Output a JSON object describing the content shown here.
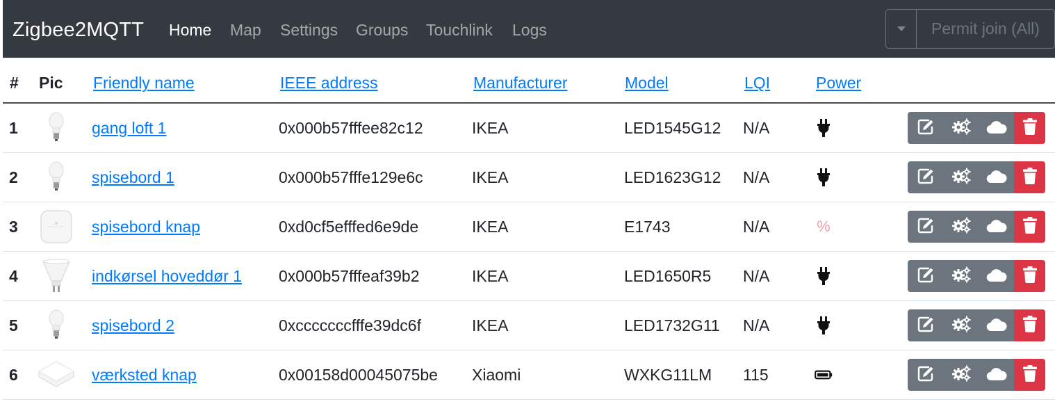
{
  "navbar": {
    "brand": "Zigbee2MQTT",
    "links": [
      {
        "label": "Home",
        "active": true
      },
      {
        "label": "Map",
        "active": false
      },
      {
        "label": "Settings",
        "active": false
      },
      {
        "label": "Groups",
        "active": false
      },
      {
        "label": "Touchlink",
        "active": false
      },
      {
        "label": "Logs",
        "active": false
      }
    ],
    "permit_join_label": "Permit join (All)",
    "permit_dropdown_icon": "caret-down-icon"
  },
  "table": {
    "headers": {
      "index": "#",
      "pic": "Pic",
      "friendly_name": "Friendly name",
      "ieee_address": "IEEE address",
      "manufacturer": "Manufacturer",
      "model": "Model",
      "lqi": "LQI",
      "power": "Power"
    },
    "rows": [
      {
        "index": "1",
        "pic": "bulb-icon",
        "friendly_name": "gang loft 1",
        "ieee_address": "0x000b57fffee82c12",
        "manufacturer": "IKEA",
        "model": "LED1545G12",
        "lqi": "N/A",
        "power": "plug-icon"
      },
      {
        "index": "2",
        "pic": "bulb-icon",
        "friendly_name": "spisebord 1",
        "ieee_address": "0x000b57fffe129e6c",
        "manufacturer": "IKEA",
        "model": "LED1623G12",
        "lqi": "N/A",
        "power": "plug-icon"
      },
      {
        "index": "3",
        "pic": "remote-icon",
        "friendly_name": "spisebord knap",
        "ieee_address": "0xd0cf5efffed6e9de",
        "manufacturer": "IKEA",
        "model": "E1743",
        "lqi": "N/A",
        "power": "%"
      },
      {
        "index": "4",
        "pic": "spotlight-icon",
        "friendly_name": "indkørsel hoveddør 1",
        "ieee_address": "0x000b57fffeaf39b2",
        "manufacturer": "IKEA",
        "model": "LED1650R5",
        "lqi": "N/A",
        "power": "plug-icon"
      },
      {
        "index": "5",
        "pic": "bulb-icon",
        "friendly_name": "spisebord 2",
        "ieee_address": "0xcccccccfffe39dc6f",
        "manufacturer": "IKEA",
        "model": "LED1732G11",
        "lqi": "N/A",
        "power": "plug-icon"
      },
      {
        "index": "6",
        "pic": "button-icon",
        "friendly_name": "værksted knap",
        "ieee_address": "0x00158d00045075be",
        "manufacturer": "Xiaomi",
        "model": "WXKG11LM",
        "lqi": "115",
        "power": "battery-icon"
      }
    ],
    "row_actions": [
      "edit-icon",
      "cogs-icon",
      "cloud-icon",
      "trash-icon"
    ]
  },
  "colors": {
    "navbar_bg": "#343a40",
    "link": "#007bff",
    "secondary": "#6c757d",
    "danger": "#dc3545",
    "power_percent": "#f1a2ab"
  }
}
